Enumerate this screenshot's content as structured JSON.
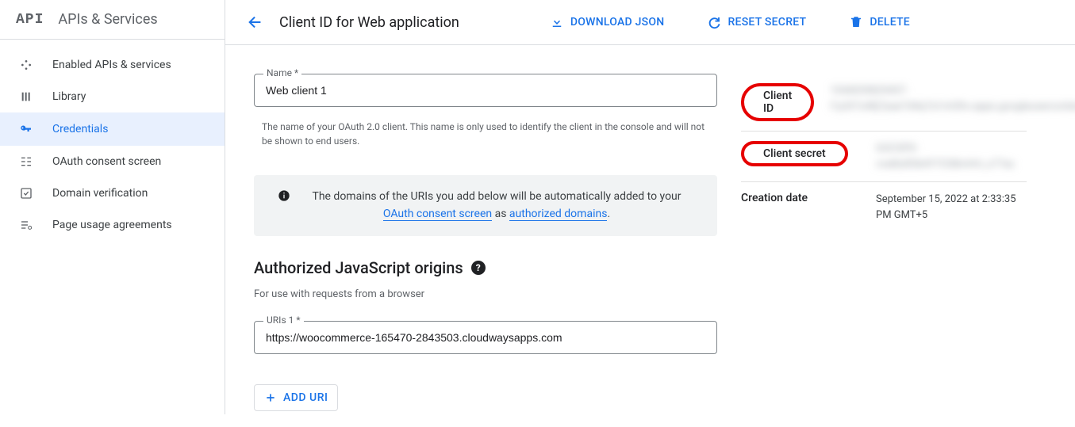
{
  "sidebar": {
    "logo": "API",
    "title": "APIs & Services",
    "items": [
      {
        "label": "Enabled APIs & services"
      },
      {
        "label": "Library"
      },
      {
        "label": "Credentials"
      },
      {
        "label": "OAuth consent screen"
      },
      {
        "label": "Domain verification"
      },
      {
        "label": "Page usage agreements"
      }
    ]
  },
  "topbar": {
    "title": "Client ID for Web application",
    "download": "DOWNLOAD JSON",
    "reset": "RESET SECRET",
    "delete": "DELETE"
  },
  "form": {
    "name_label": "Name *",
    "name_value": "Web client 1",
    "name_helper": "The name of your OAuth 2.0 client. This name is only used to identify the client in the console and will not be shown to end users.",
    "info_box_pre": "The domains of the URIs you add below will be automatically added to your ",
    "info_link1": "OAuth consent screen",
    "info_mid": " as ",
    "info_link2": "authorized domains",
    "section_heading": "Authorized JavaScript origins",
    "section_sub": "For use with requests from a browser",
    "uri_label": "URIs 1 *",
    "uri_value": "https://woocommerce-165470-2843503.cloudwaysapps.com",
    "add_uri": "ADD URI"
  },
  "details": {
    "client_id_label": "Client ID",
    "client_id_value": "1044039829457-l1p3t7o48j7pae7d4q7a1mt3hv.apps.googleusercontent.com",
    "client_secret_label": "Client secret",
    "client_secret_value": "GOCSPX-vve8tzR3k4Y7C08mHrt_x77ac",
    "creation_label": "Creation date",
    "creation_value": "September 15, 2022 at 2:33:35 PM GMT+5"
  }
}
